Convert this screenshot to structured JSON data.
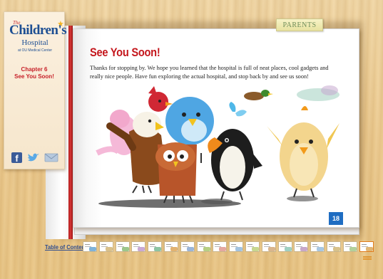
{
  "logo": {
    "the": "The",
    "name": "Children's",
    "hospital": "Hospital",
    "sub": "at OU Medical Center"
  },
  "sidebar": {
    "chapter_label": "Chapter 6",
    "chapter_title": "See You Soon!",
    "social": [
      "facebook-icon",
      "twitter-icon",
      "mail-icon"
    ]
  },
  "tabs": {
    "parents": "PARENTS"
  },
  "content": {
    "title": "See You Soon!",
    "body": "Thanks for stopping by. We hope you learned that the hospital is full of neat places, cool gadgets and really nice people. Have fun exploring the actual hospital, and stop back by and see us soon!",
    "page_number": "18"
  },
  "nav": {
    "toc_label": "Table of Contents",
    "thumbnail_count": 18,
    "active_index": 17,
    "thumb_colors": [
      "#7fb2d9",
      "#d9c08a",
      "#9cc68a",
      "#c9a9d4",
      "#8dc4a3",
      "#e2b270",
      "#9bb5d8",
      "#b7cf83",
      "#e4a7a0",
      "#a3c3e0",
      "#c7d78f",
      "#d9b58d",
      "#9fd0c2",
      "#c8a7c9",
      "#a8c7e2",
      "#d8c28a",
      "#b2d09a",
      "#e0b574"
    ]
  },
  "colors": {
    "accent_red": "#c4161c",
    "page_number_blue": "#1f6dc2",
    "link_blue": "#2e4c8f"
  }
}
